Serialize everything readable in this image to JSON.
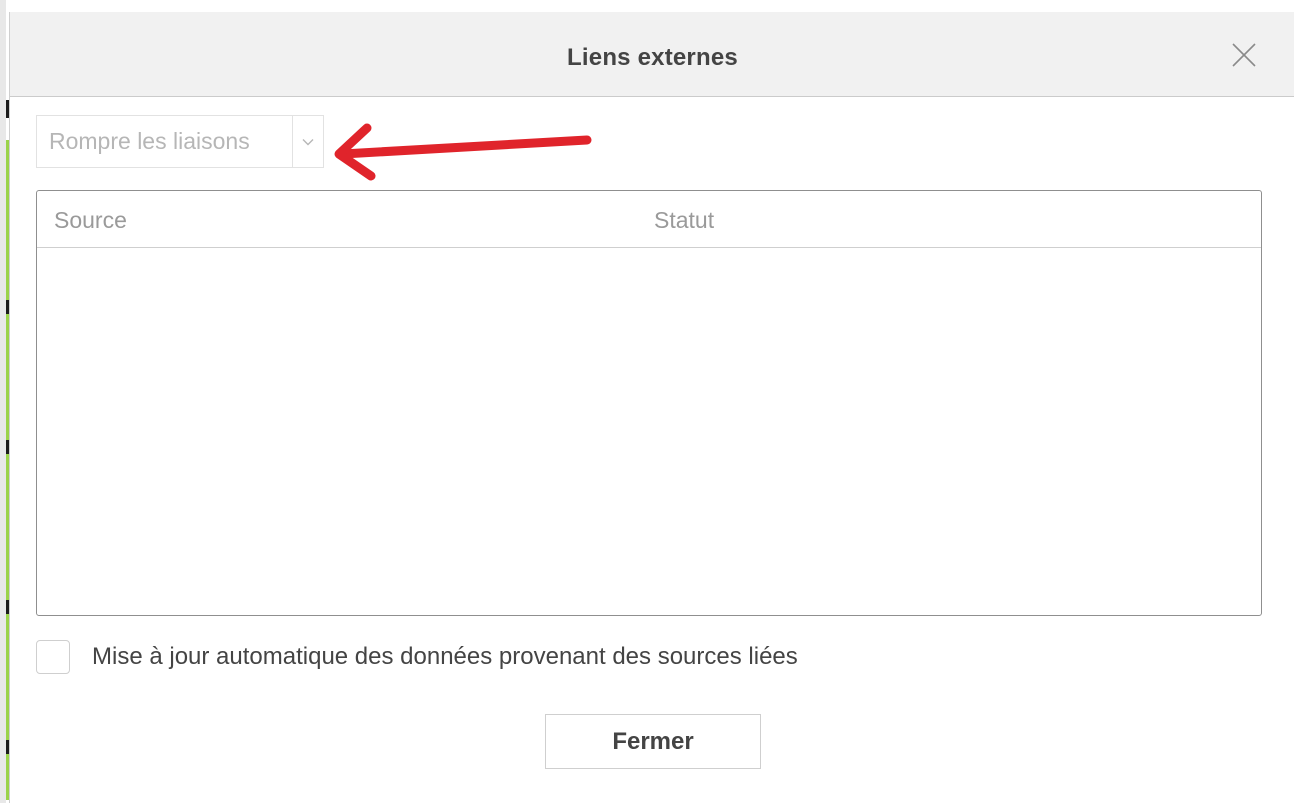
{
  "dialog": {
    "title": "Liens externes",
    "close_icon": "close-x-icon"
  },
  "toolbar": {
    "dropdown_label": "Rompre les liaisons",
    "dropdown_icon": "chevron-down-icon",
    "annotation_icon": "red-arrow-annotation-icon",
    "annotation_color": "#e0242b"
  },
  "table": {
    "columns": [
      "Source",
      "Statut"
    ],
    "rows": []
  },
  "auto_update": {
    "label": "Mise à jour automatique des données provenant des sources liées",
    "checked": false
  },
  "footer": {
    "close_label": "Fermer"
  }
}
